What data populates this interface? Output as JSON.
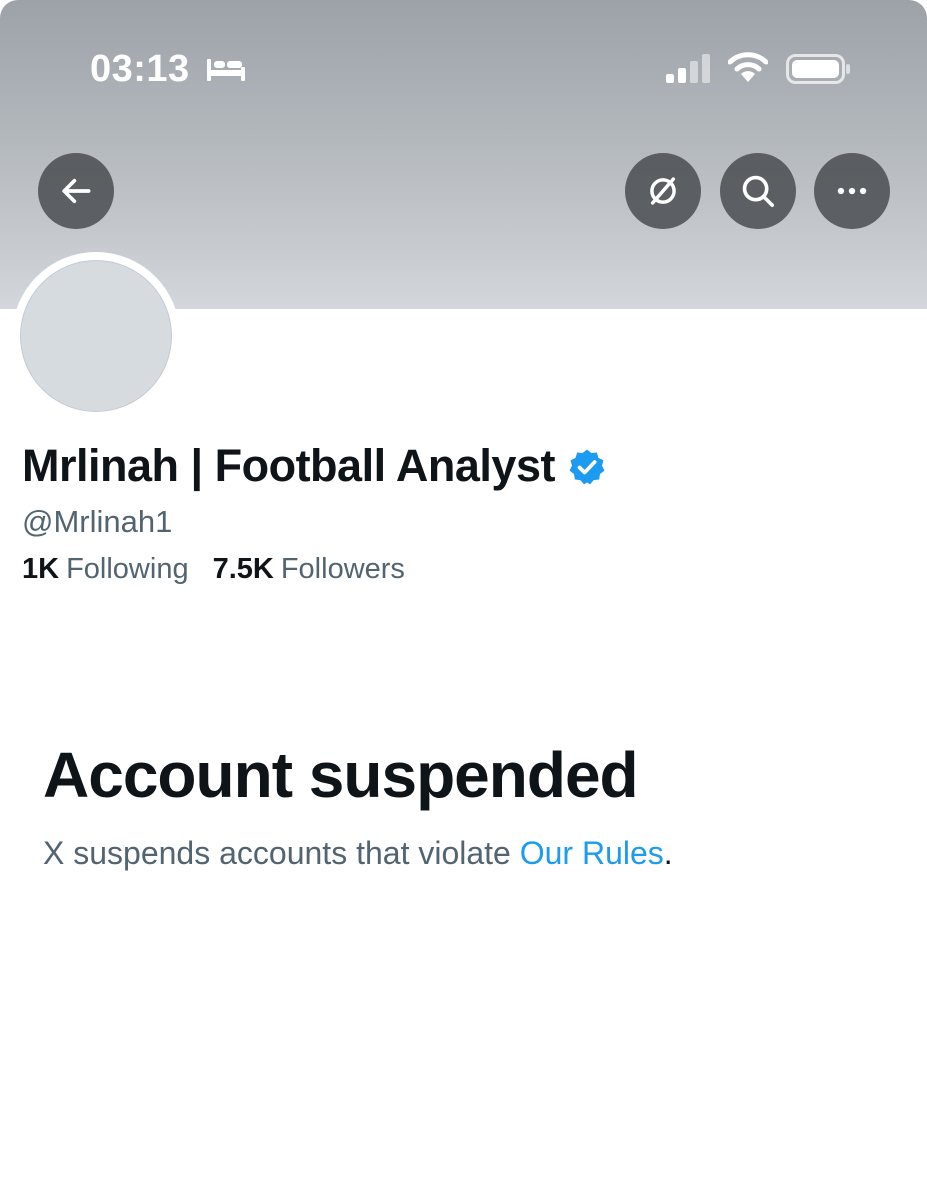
{
  "status_bar": {
    "time": "03:13",
    "icons": [
      "bed-icon",
      "cellular-signal-icon",
      "wifi-icon",
      "battery-icon"
    ]
  },
  "header": {
    "buttons": [
      "back-arrow-icon",
      "mute-icon",
      "search-icon",
      "more-options-icon"
    ]
  },
  "profile": {
    "display_name": "Mrlinah | Football Analyst",
    "verified": true,
    "handle": "@Mrlinah1",
    "following_count": "1K",
    "following_label": "Following",
    "followers_count": "7.5K",
    "followers_label": "Followers"
  },
  "suspension": {
    "title": "Account suspended",
    "message": "X suspends accounts that violate ",
    "link_text": "Our Rules",
    "punctuation": "."
  },
  "colors": {
    "text_primary": "#0f1419",
    "text_secondary": "#536471",
    "link": "#1d9bf0",
    "verified_badge": "#1d9bf0",
    "avatar_placeholder": "#d6dbdf"
  }
}
